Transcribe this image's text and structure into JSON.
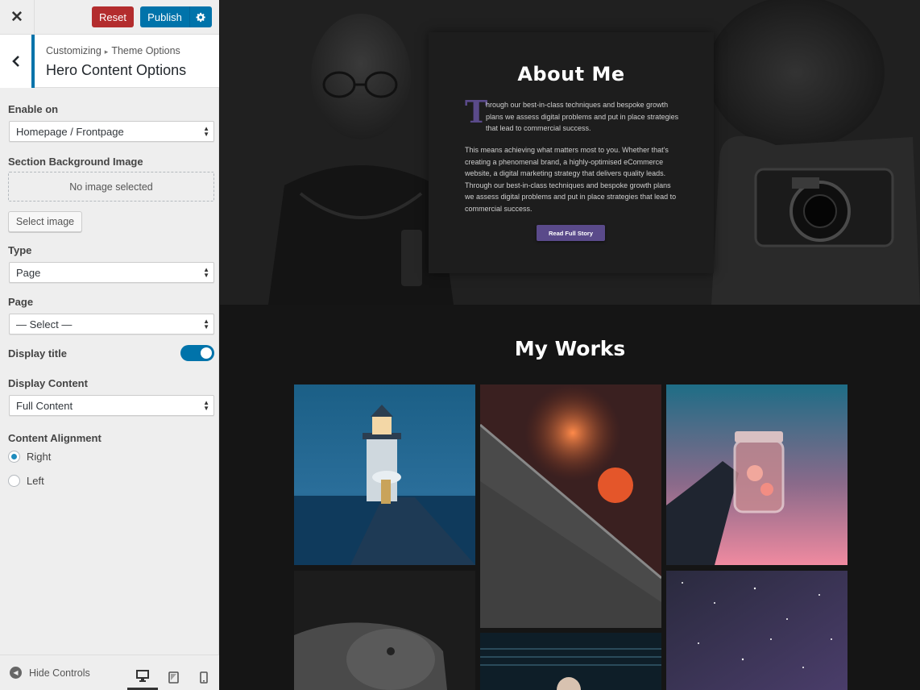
{
  "sidebar": {
    "header": {
      "close_label": "✕",
      "reset_label": "Reset",
      "publish_label": "Publish",
      "settings_glyph": "⚙"
    },
    "section": {
      "back_glyph": "‹",
      "breadcrumb": [
        "Customizing",
        "Theme Options"
      ],
      "breadcrumb_separator": "▸",
      "title": "Hero Content Options"
    },
    "fields": {
      "enable_on": {
        "label": "Enable on",
        "value": "Homepage / Frontpage"
      },
      "background_image": {
        "label": "Section Background Image",
        "placeholder": "No image selected",
        "button": "Select image"
      },
      "type": {
        "label": "Type",
        "value": "Page"
      },
      "page": {
        "label": "Page",
        "value": "— Select —"
      },
      "display_title": {
        "label": "Display title",
        "enabled": true
      },
      "display_content": {
        "label": "Display Content",
        "value": "Full Content"
      },
      "content_alignment": {
        "label": "Content Alignment",
        "options": [
          {
            "label": "Right",
            "checked": true
          },
          {
            "label": "Left",
            "checked": false
          }
        ]
      }
    },
    "footer": {
      "hide_controls": "Hide Controls",
      "devices": [
        "desktop-icon",
        "tablet-icon",
        "mobile-icon"
      ],
      "active_device": "desktop"
    }
  },
  "preview": {
    "about": {
      "title": "About Me",
      "dropcap": "T",
      "paragraph1": "hrough our best-in-class techniques and bespoke growth plans we assess digital problems and put in place strategies that lead to commercial success.",
      "paragraph2": "This means achieving what matters most to you. Whether that's creating a phenomenal brand, a highly-optimised eCommerce website, a digital marketing strategy that delivers quality leads. Through our best-in-class techniques and bespoke growth plans we assess digital problems and put in place strategies that lead to commercial success.",
      "button": "Read Full Story"
    },
    "works": {
      "title": "My Works",
      "images": [
        "lighthouse-image",
        "umbrella-drops-image",
        "jar-lights-image",
        "dog-image",
        "portrait-image",
        "starry-sky-image"
      ]
    }
  },
  "colors": {
    "accent_blue": "#0073aa",
    "reset_red": "#b32d2e",
    "theme_purple": "#5a4a8a"
  }
}
